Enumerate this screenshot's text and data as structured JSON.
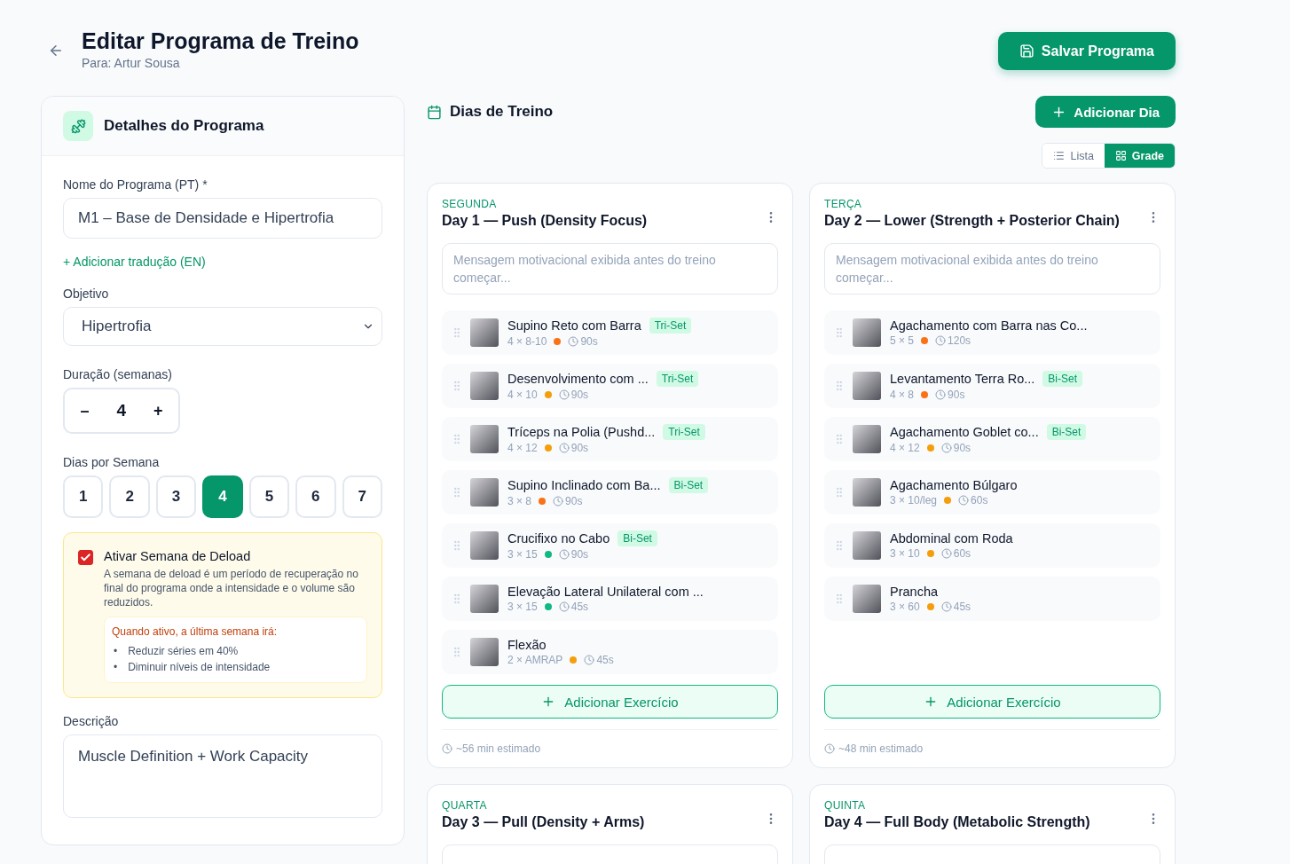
{
  "header": {
    "title": "Editar Programa de Treino",
    "subtitle": "Para: Artur Sousa",
    "save_button": "Salvar Programa"
  },
  "details": {
    "title": "Detalhes do Programa",
    "name_label": "Nome do Programa (PT) *",
    "name_value": "M1 – Base de Densidade e Hipertrofia",
    "add_translation": "+ Adicionar tradução (EN)",
    "objective_label": "Objetivo",
    "objective_value": "Hipertrofia",
    "duration_label": "Duração (semanas)",
    "decrement": "–",
    "duration_value": "4",
    "increment": "+",
    "days_label": "Dias por Semana",
    "days_options": [
      {
        "label": "1",
        "selected": false
      },
      {
        "label": "2",
        "selected": false
      },
      {
        "label": "3",
        "selected": false
      },
      {
        "label": "4",
        "selected": true
      },
      {
        "label": "5",
        "selected": false
      },
      {
        "label": "6",
        "selected": false
      },
      {
        "label": "7",
        "selected": false
      }
    ],
    "deload": {
      "checked": true,
      "title": "Ativar Semana de Deload",
      "description": "A semana de deload é um período de recuperação no final do programa onde a intensidade e o volume são reduzidos.",
      "note_title": "Quando ativo, a última semana irá:",
      "note_items": [
        {
          "marker": "•",
          "text": "Reduzir séries em 40%"
        },
        {
          "marker": "•",
          "text": "Diminuir níveis de intensidade"
        }
      ]
    },
    "description_label": "Descrição",
    "description_value": "Muscle Definition + Work Capacity"
  },
  "days_section": {
    "title": "Dias de Treino",
    "add_day": "Adicionar Dia",
    "view_toggle": [
      {
        "label": "Lista",
        "kind": "list",
        "selected": false
      },
      {
        "label": "Grade",
        "kind": "grid",
        "selected": true
      }
    ],
    "days": [
      {
        "weekday": "SEGUNDA",
        "title": "Day 1 — Push (Density Focus)",
        "message_placeholder": "Mensagem motivacional exibida antes do treino começar...",
        "exercises": [
          {
            "name": "Supino Reto com Barra",
            "scheme": "4 × 8-10",
            "rest": "90s",
            "badge": "Tri-Set",
            "color": "#f97316"
          },
          {
            "name": "Desenvolvimento com ...",
            "scheme": "4 × 10",
            "rest": "90s",
            "badge": "Tri-Set",
            "color": "#f59e0b"
          },
          {
            "name": "Tríceps na Polia (Pushd...",
            "scheme": "4 × 12",
            "rest": "90s",
            "badge": "Tri-Set",
            "color": "#f59e0b"
          },
          {
            "name": "Supino Inclinado com Ba...",
            "scheme": "3 × 8",
            "rest": "90s",
            "badge": "Bi-Set",
            "color": "#f97316"
          },
          {
            "name": "Crucifixo no Cabo",
            "scheme": "3 × 15",
            "rest": "90s",
            "badge": "Bi-Set",
            "color": "#10b981"
          },
          {
            "name": "Elevação Lateral Unilateral com ...",
            "scheme": "3 × 15",
            "rest": "45s",
            "color": "#10b981"
          },
          {
            "name": "Flexão",
            "scheme": "2 × AMRAP",
            "rest": "45s",
            "color": "#f59e0b"
          }
        ],
        "add_exercise": "Adicionar Exercício",
        "estimate": "~56 min estimado"
      },
      {
        "weekday": "TERÇA",
        "title": "Day 2 — Lower (Strength + Posterior Chain)",
        "message_placeholder": "Mensagem motivacional exibida antes do treino começar...",
        "exercises": [
          {
            "name": "Agachamento com Barra nas Co...",
            "scheme": "5 × 5",
            "rest": "120s",
            "color": "#f97316"
          },
          {
            "name": "Levantamento Terra Ro...",
            "scheme": "4 × 8",
            "rest": "90s",
            "badge": "Bi-Set",
            "color": "#f97316"
          },
          {
            "name": "Agachamento Goblet co...",
            "scheme": "4 × 12",
            "rest": "90s",
            "badge": "Bi-Set",
            "color": "#f59e0b"
          },
          {
            "name": "Agachamento Búlgaro",
            "scheme": "3 × 10/leg",
            "rest": "60s",
            "color": "#f59e0b"
          },
          {
            "name": "Abdominal com Roda",
            "scheme": "3 × 10",
            "rest": "60s",
            "color": "#f59e0b"
          },
          {
            "name": "Prancha",
            "scheme": "3 × 60",
            "rest": "45s",
            "color": "#f59e0b"
          }
        ],
        "add_exercise": "Adicionar Exercício",
        "estimate": "~48 min estimado"
      },
      {
        "weekday": "QUARTA",
        "title": "Day 3 — Pull (Density + Arms)"
      },
      {
        "weekday": "QUINTA",
        "title": "Day 4 — Full Body (Metabolic Strength)"
      }
    ]
  }
}
